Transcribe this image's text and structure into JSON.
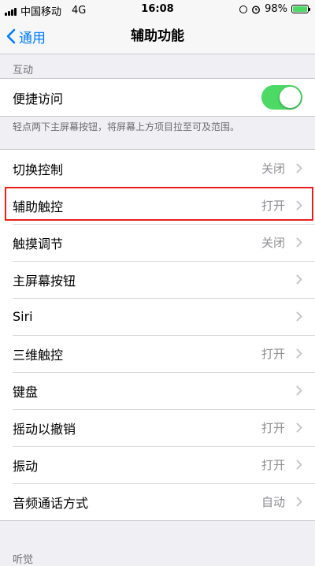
{
  "status_bar": {
    "carrier": "中国移动",
    "network": "4G",
    "time": "16:08",
    "battery_percent": "98%",
    "battery_level": 0.98,
    "battery_color": "#4cd964"
  },
  "nav": {
    "back_label": "通用",
    "title": "辅助功能"
  },
  "section_interaction": {
    "header": "互动",
    "reachability_label": "便捷访问",
    "reachability_on": true,
    "footer": "轻点两下主屏幕按钮，将屏幕上方项目拉至可及范围。"
  },
  "settings_items": [
    {
      "label": "切换控制",
      "value": "关闭"
    },
    {
      "label": "辅助触控",
      "value": "打开"
    },
    {
      "label": "触摸调节",
      "value": "关闭"
    },
    {
      "label": "主屏幕按钮",
      "value": ""
    },
    {
      "label": "Siri",
      "value": ""
    },
    {
      "label": "三维触控",
      "value": "打开"
    },
    {
      "label": "键盘",
      "value": ""
    },
    {
      "label": "摇动以撤销",
      "value": "打开"
    },
    {
      "label": "振动",
      "value": "打开"
    },
    {
      "label": "音频通话方式",
      "value": "自动"
    }
  ],
  "section_hearing": {
    "header": "听觉"
  },
  "colors": {
    "accent": "#007aff",
    "toggle_on": "#4cd964",
    "highlight": "#e8201c",
    "background": "#efeff4"
  }
}
